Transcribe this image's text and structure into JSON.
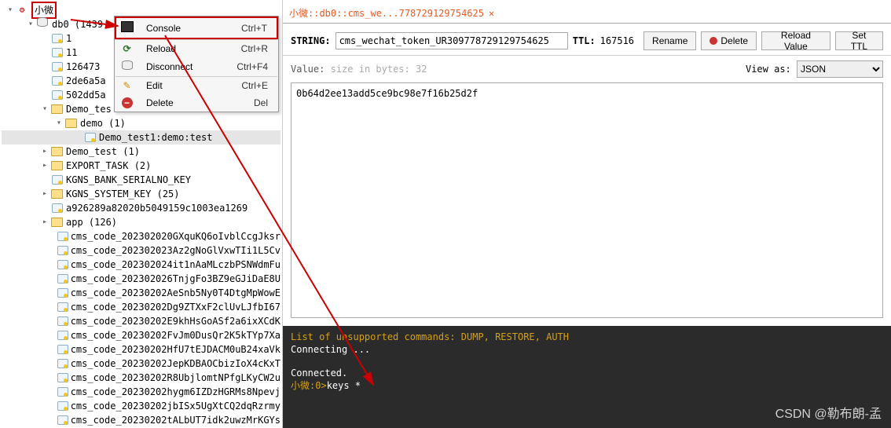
{
  "connection": {
    "name": "小微"
  },
  "db": {
    "name": "db0",
    "count_suffix": "(1439"
  },
  "db_keys_top": [
    {
      "label": "1"
    },
    {
      "label": "11"
    },
    {
      "label": "126473"
    },
    {
      "label": "2de6a5a"
    },
    {
      "label": "502dd5a"
    }
  ],
  "demo_test1": {
    "label": "Demo_tes"
  },
  "demo_folder": {
    "label": "demo (1)"
  },
  "demo_key": {
    "label": "Demo_test1:demo:test"
  },
  "folders": [
    {
      "label": "Demo_test (1)"
    },
    {
      "label": "EXPORT_TASK (2)"
    }
  ],
  "standalone_keys": [
    {
      "label": "KGNS_BANK_SERIALNO_KEY"
    },
    {
      "label": "KGNS_SYSTEM_KEY (25)"
    },
    {
      "label": "a926289a82020b5049159c1003ea1269"
    }
  ],
  "app_folder": {
    "label": "app (126)"
  },
  "app_keys": [
    "cms_code_202302020GXquKQ6oIvblCcgJksr",
    "cms_code_202302023Az2gNoGlVxwTIi1L5Cv",
    "cms_code_202302024it1nAaMLczbPSNWdmFu",
    "cms_code_202302026TnjgFo3BZ9eGJiDaE8U",
    "cms_code_20230202AeSnb5Ny0T4DtgMpWowE",
    "cms_code_20230202Dg9ZTXxF2clUvLJfbI67",
    "cms_code_20230202E9khHsGoASf2a6ixXCdK",
    "cms_code_20230202FvJm0DusQr2K5kTYp7Xa",
    "cms_code_20230202HfU7tEJDACM0uB24xaVk",
    "cms_code_20230202JepKDBAOCbizIoX4cKxT",
    "cms_code_20230202R8UbjlomtNPfgLKyCW2u",
    "cms_code_20230202hygm6IZDzHGRMs8Npevj",
    "cms_code_20230202jbISx5UgXtCQ2dqRzrmy",
    "cms_code_20230202tALbUT7idk2uwzMrKGYs"
  ],
  "ctxmenu": {
    "console": {
      "label": "Console",
      "accel": "Ctrl+T"
    },
    "reload": {
      "label": "Reload",
      "accel": "Ctrl+R"
    },
    "disc": {
      "label": "Disconnect",
      "accel": "Ctrl+F4"
    },
    "edit": {
      "label": "Edit",
      "accel": "Ctrl+E"
    },
    "del": {
      "label": "Delete",
      "accel": "Del"
    }
  },
  "tab": {
    "title": "小微::db0::cms_we...778729129754625"
  },
  "props": {
    "type_label": "STRING:",
    "key_value": "cms_wechat_token_UR309778729129754625",
    "ttl_label": "TTL:",
    "ttl_value": "167516",
    "btn_rename": "Rename",
    "btn_delete": "Delete",
    "btn_reload": "Reload Value",
    "btn_setttl": "Set TTL"
  },
  "value_row": {
    "label": "Value:",
    "hint": "size in bytes: 32",
    "view_as_label": "View as:",
    "view_as_value": "JSON"
  },
  "value_content": "0b64d2ee13add5ce9bc98e7f16b25d2f",
  "console": {
    "warn": "List of unsupported commands: DUMP, RESTORE, AUTH",
    "connecting": "Connecting ...",
    "connected": "Connected.",
    "prompt_prefix": "小微:0>",
    "prompt_cmd": "keys *"
  },
  "watermark": "CSDN @勒布朗-孟"
}
